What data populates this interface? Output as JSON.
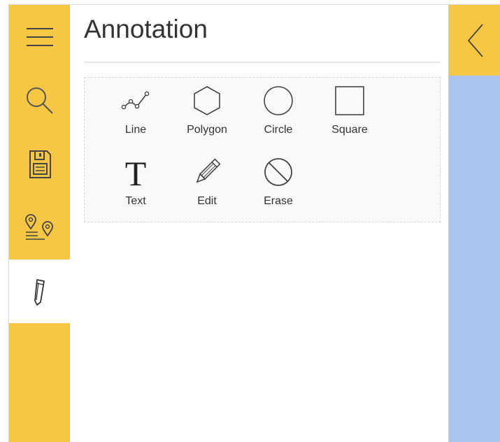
{
  "rail": {
    "items": [
      {
        "icon": "menu-icon",
        "active": false
      },
      {
        "icon": "search-icon",
        "active": false
      },
      {
        "icon": "save-icon",
        "active": false
      },
      {
        "icon": "route-icon",
        "active": false
      },
      {
        "icon": "pencil-icon",
        "active": true
      }
    ],
    "background": "#f7c744",
    "active_background": "#ffffff"
  },
  "panel": {
    "title": "Annotation",
    "tools": [
      {
        "label": "Line",
        "icon": "line-icon"
      },
      {
        "label": "Polygon",
        "icon": "polygon-icon"
      },
      {
        "label": "Circle",
        "icon": "circle-icon"
      },
      {
        "label": "Square",
        "icon": "square-icon"
      },
      {
        "label": "Text",
        "icon": "text-icon"
      },
      {
        "label": "Edit",
        "icon": "edit-icon"
      },
      {
        "label": "Erase",
        "icon": "erase-icon"
      }
    ]
  },
  "collapse": {
    "icon": "chevron-left-icon"
  },
  "colors": {
    "accent": "#f7c744",
    "map": "#a9c5ef"
  }
}
